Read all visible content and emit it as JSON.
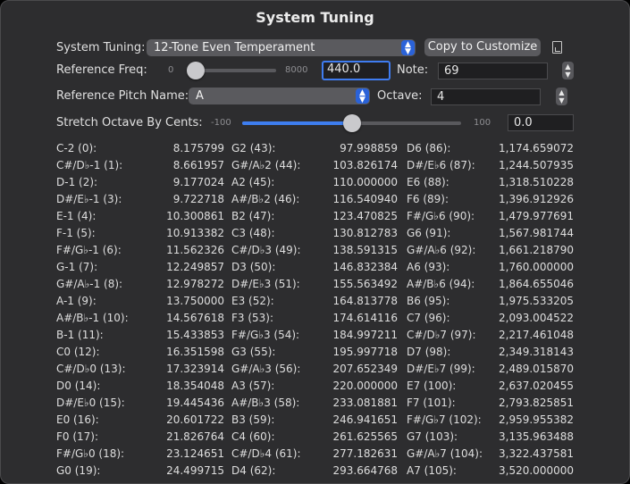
{
  "title": "System Tuning",
  "system_tuning": {
    "label": "System Tuning:",
    "value": "12-Tone Even Temperament",
    "copy_button": "Copy to Customize",
    "doc_icon": "document-icon"
  },
  "reference_freq": {
    "label": "Reference Freq:",
    "min": "0",
    "max": "8000",
    "slider_fraction": 0.055,
    "value": "440.0",
    "note_label": "Note:",
    "note_value": "69"
  },
  "reference_pitch": {
    "label": "Reference Pitch Name:",
    "value": "A",
    "octave_label": "Octave:",
    "octave_value": "4"
  },
  "stretch": {
    "label": "Stretch Octave By Cents:",
    "min": "-100",
    "max": "100",
    "slider_fraction": 0.5,
    "value": "0.0"
  },
  "table": {
    "rows": [
      [
        [
          "C-2 (0):",
          "8.175799"
        ],
        [
          "G2 (43):",
          "97.998859"
        ],
        [
          "D6 (86):",
          "1,174.659072"
        ]
      ],
      [
        [
          "C#/D♭-1 (1):",
          "8.661957"
        ],
        [
          "G#/A♭2 (44):",
          "103.826174"
        ],
        [
          "D#/E♭6 (87):",
          "1,244.507935"
        ]
      ],
      [
        [
          "D-1 (2):",
          "9.177024"
        ],
        [
          "A2 (45):",
          "110.000000"
        ],
        [
          "E6 (88):",
          "1,318.510228"
        ]
      ],
      [
        [
          "D#/E♭-1 (3):",
          "9.722718"
        ],
        [
          "A#/B♭2 (46):",
          "116.540940"
        ],
        [
          "F6 (89):",
          "1,396.912926"
        ]
      ],
      [
        [
          "E-1 (4):",
          "10.300861"
        ],
        [
          "B2 (47):",
          "123.470825"
        ],
        [
          "F#/G♭6 (90):",
          "1,479.977691"
        ]
      ],
      [
        [
          "F-1 (5):",
          "10.913382"
        ],
        [
          "C3 (48):",
          "130.812783"
        ],
        [
          "G6 (91):",
          "1,567.981744"
        ]
      ],
      [
        [
          "F#/G♭-1 (6):",
          "11.562326"
        ],
        [
          "C#/D♭3 (49):",
          "138.591315"
        ],
        [
          "G#/A♭6 (92):",
          "1,661.218790"
        ]
      ],
      [
        [
          "G-1 (7):",
          "12.249857"
        ],
        [
          "D3 (50):",
          "146.832384"
        ],
        [
          "A6 (93):",
          "1,760.000000"
        ]
      ],
      [
        [
          "G#/A♭-1 (8):",
          "12.978272"
        ],
        [
          "D#/E♭3 (51):",
          "155.563492"
        ],
        [
          "A#/B♭6 (94):",
          "1,864.655046"
        ]
      ],
      [
        [
          "A-1 (9):",
          "13.750000"
        ],
        [
          "E3 (52):",
          "164.813778"
        ],
        [
          "B6 (95):",
          "1,975.533205"
        ]
      ],
      [
        [
          "A#/B♭-1 (10):",
          "14.567618"
        ],
        [
          "F3 (53):",
          "174.614116"
        ],
        [
          "C7 (96):",
          "2,093.004522"
        ]
      ],
      [
        [
          "B-1 (11):",
          "15.433853"
        ],
        [
          "F#/G♭3 (54):",
          "184.997211"
        ],
        [
          "C#/D♭7 (97):",
          "2,217.461048"
        ]
      ],
      [
        [
          "C0 (12):",
          "16.351598"
        ],
        [
          "G3 (55):",
          "195.997718"
        ],
        [
          "D7 (98):",
          "2,349.318143"
        ]
      ],
      [
        [
          "C#/D♭0 (13):",
          "17.323914"
        ],
        [
          "G#/A♭3 (56):",
          "207.652349"
        ],
        [
          "D#/E♭7 (99):",
          "2,489.015870"
        ]
      ],
      [
        [
          "D0 (14):",
          "18.354048"
        ],
        [
          "A3 (57):",
          "220.000000"
        ],
        [
          "E7 (100):",
          "2,637.020455"
        ]
      ],
      [
        [
          "D#/E♭0 (15):",
          "19.445436"
        ],
        [
          "A#/B♭3 (58):",
          "233.081881"
        ],
        [
          "F7 (101):",
          "2,793.825851"
        ]
      ],
      [
        [
          "E0 (16):",
          "20.601722"
        ],
        [
          "B3 (59):",
          "246.941651"
        ],
        [
          "F#/G♭7 (102):",
          "2,959.955382"
        ]
      ],
      [
        [
          "F0 (17):",
          "21.826764"
        ],
        [
          "C4 (60):",
          "261.625565"
        ],
        [
          "G7 (103):",
          "3,135.963488"
        ]
      ],
      [
        [
          "F#/G♭0 (18):",
          "23.124651"
        ],
        [
          "C#/D♭4 (61):",
          "277.182631"
        ],
        [
          "G#/A♭7 (104):",
          "3,322.437581"
        ]
      ],
      [
        [
          "G0 (19):",
          "24.499715"
        ],
        [
          "D4 (62):",
          "293.664768"
        ],
        [
          "A7 (105):",
          "3,520.000000"
        ]
      ]
    ]
  }
}
